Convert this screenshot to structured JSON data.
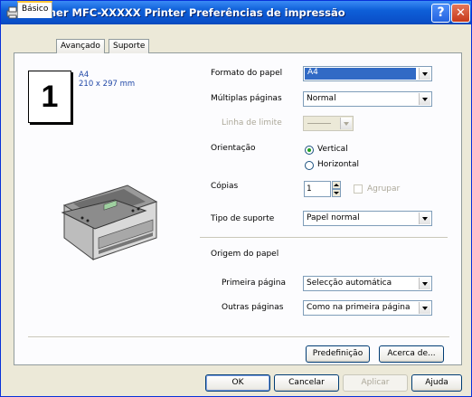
{
  "window": {
    "title": "Brother MFC-XXXXX Printer Preferências de impressão",
    "help_button": "?",
    "close_button": "✕"
  },
  "tabs": [
    {
      "label": "Básico",
      "active": true
    },
    {
      "label": "Avançado",
      "active": false
    },
    {
      "label": "Suporte",
      "active": false
    }
  ],
  "preview": {
    "page_count": "1",
    "paper_name": "A4",
    "paper_dims": "210 x 297 mm"
  },
  "form": {
    "paper_size": {
      "label": "Formato do papel",
      "value": "A4"
    },
    "multiple_pages": {
      "label": "Múltiplas páginas",
      "value": "Normal"
    },
    "border_line": {
      "label": "Linha de limite",
      "value": ""
    },
    "orientation": {
      "label": "Orientação",
      "options": [
        "Vertical",
        "Horizontal"
      ],
      "selected": "Vertical"
    },
    "copies": {
      "label": "Cópias",
      "value": "1",
      "collate_label": "Agrupar"
    },
    "media_type": {
      "label": "Tipo de suporte",
      "value": "Papel normal"
    },
    "paper_source": {
      "label": "Origem do papel",
      "first_page": {
        "label": "Primeira página",
        "value": "Selecção automática"
      },
      "other_pages": {
        "label": "Outras páginas",
        "value": "Como na primeira página"
      }
    }
  },
  "panel_buttons": {
    "default": "Predefinição",
    "about": "Acerca de..."
  },
  "dialog_buttons": {
    "ok": "OK",
    "cancel": "Cancelar",
    "apply": "Aplicar",
    "help": "Ajuda"
  }
}
